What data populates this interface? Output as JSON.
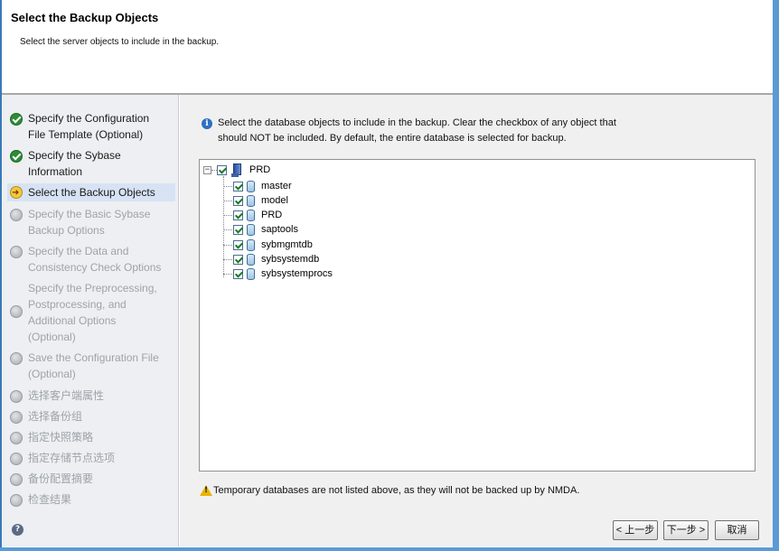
{
  "header": {
    "title": "Select the Backup Objects",
    "subtitle": "Select the server objects to include in the backup."
  },
  "sidebar": {
    "steps": [
      {
        "label": "Specify the Configuration\nFile Template (Optional)",
        "state": "done"
      },
      {
        "label": "Specify the Sybase\nInformation",
        "state": "done"
      },
      {
        "label": "Select the Backup Objects",
        "state": "current"
      },
      {
        "label": "Specify the Basic Sybase\nBackup Options",
        "state": "pending"
      },
      {
        "label": "Specify the Data and\nConsistency Check Options",
        "state": "pending"
      },
      {
        "label": "Specify the Preprocessing,\nPostprocessing, and\nAdditional Options\n(Optional)",
        "state": "pending"
      },
      {
        "label": "Save the Configuration File\n(Optional)",
        "state": "pending"
      },
      {
        "label": "选择客户端属性",
        "state": "pending"
      },
      {
        "label": "选择备份组",
        "state": "pending"
      },
      {
        "label": "指定快照策略",
        "state": "pending"
      },
      {
        "label": "指定存储节点选项",
        "state": "pending"
      },
      {
        "label": "备份配置摘要",
        "state": "pending"
      },
      {
        "label": "检查结果",
        "state": "pending"
      }
    ],
    "help_glyph": "?"
  },
  "main": {
    "info_glyph": "i",
    "info_text": "Select the database objects to include in the backup. Clear the checkbox of any object that should NOT be included. By default, the entire database is selected for backup.",
    "tree": {
      "root": {
        "label": "PRD",
        "checked": true,
        "expanded": true
      },
      "children": [
        {
          "label": "master",
          "checked": true
        },
        {
          "label": "model",
          "checked": true
        },
        {
          "label": "PRD",
          "checked": true
        },
        {
          "label": "saptools",
          "checked": true
        },
        {
          "label": "sybmgmtdb",
          "checked": true
        },
        {
          "label": "sybsystemdb",
          "checked": true
        },
        {
          "label": "sybsystemprocs",
          "checked": true
        }
      ]
    },
    "warning_text": "Temporary databases are not listed above, as they will not be backed up by NMDA."
  },
  "buttons": {
    "back": "< 上一步",
    "next": "下一步 >",
    "cancel": "取消"
  }
}
